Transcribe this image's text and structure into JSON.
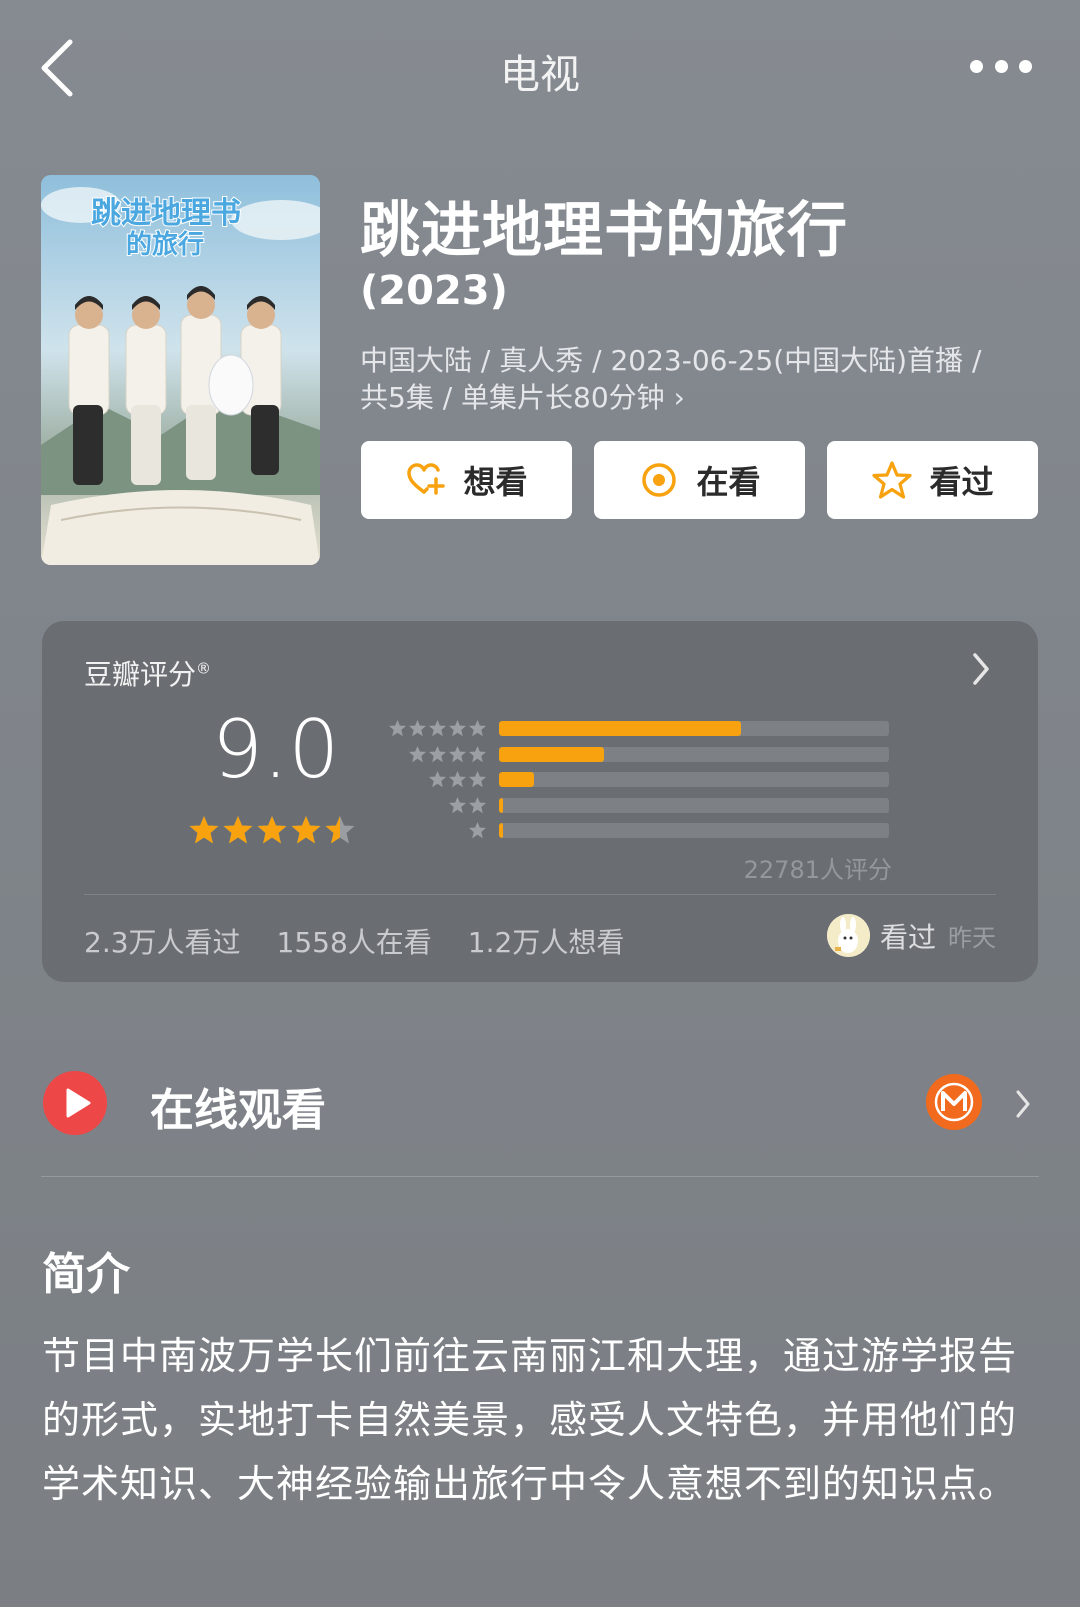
{
  "header": {
    "title": "电视"
  },
  "subject": {
    "title": "跳进地理书的旅行",
    "year": "(2023)",
    "meta_line1": "中国大陆 / 真人秀 / 2023-06-25(中国大陆)首播 /",
    "meta_line2": "共5集 / 单集片长80分钟",
    "meta_chevron": "›",
    "poster": {
      "title_art": "跳进地理书的旅行"
    }
  },
  "actions": [
    {
      "label": "想看",
      "icon": "heart-plus-icon"
    },
    {
      "label": "在看",
      "icon": "target-icon"
    },
    {
      "label": "看过",
      "icon": "star-outline-icon"
    }
  ],
  "rating": {
    "label": "豆瓣评分",
    "registered_mark": "®",
    "score": "9.0",
    "stars_value": 4.5,
    "distribution": [
      {
        "stars": 5,
        "fraction": 0.62
      },
      {
        "stars": 4,
        "fraction": 0.27
      },
      {
        "stars": 3,
        "fraction": 0.09
      },
      {
        "stars": 2,
        "fraction": 0.01
      },
      {
        "stars": 1,
        "fraction": 0.01
      }
    ],
    "count_text": "22781人评分",
    "stats": [
      "2.3万人看过",
      "1558人在看",
      "1.2万人想看"
    ],
    "friend": {
      "action": "看过",
      "time": "昨天"
    }
  },
  "online": {
    "label": "在线观看"
  },
  "synopsis": {
    "title": "简介",
    "text": "节目中南波万学长们前往云南丽江和大理，通过游学报告的形式，实地打卡自然美景，感受人文特色，并用他们的学术知识、大神经验输出旅行中令人意想不到的知识点。"
  },
  "colors": {
    "accent_orange": "#f7a20e",
    "play_red": "#ee4747",
    "mango_orange": "#f26a1d"
  }
}
